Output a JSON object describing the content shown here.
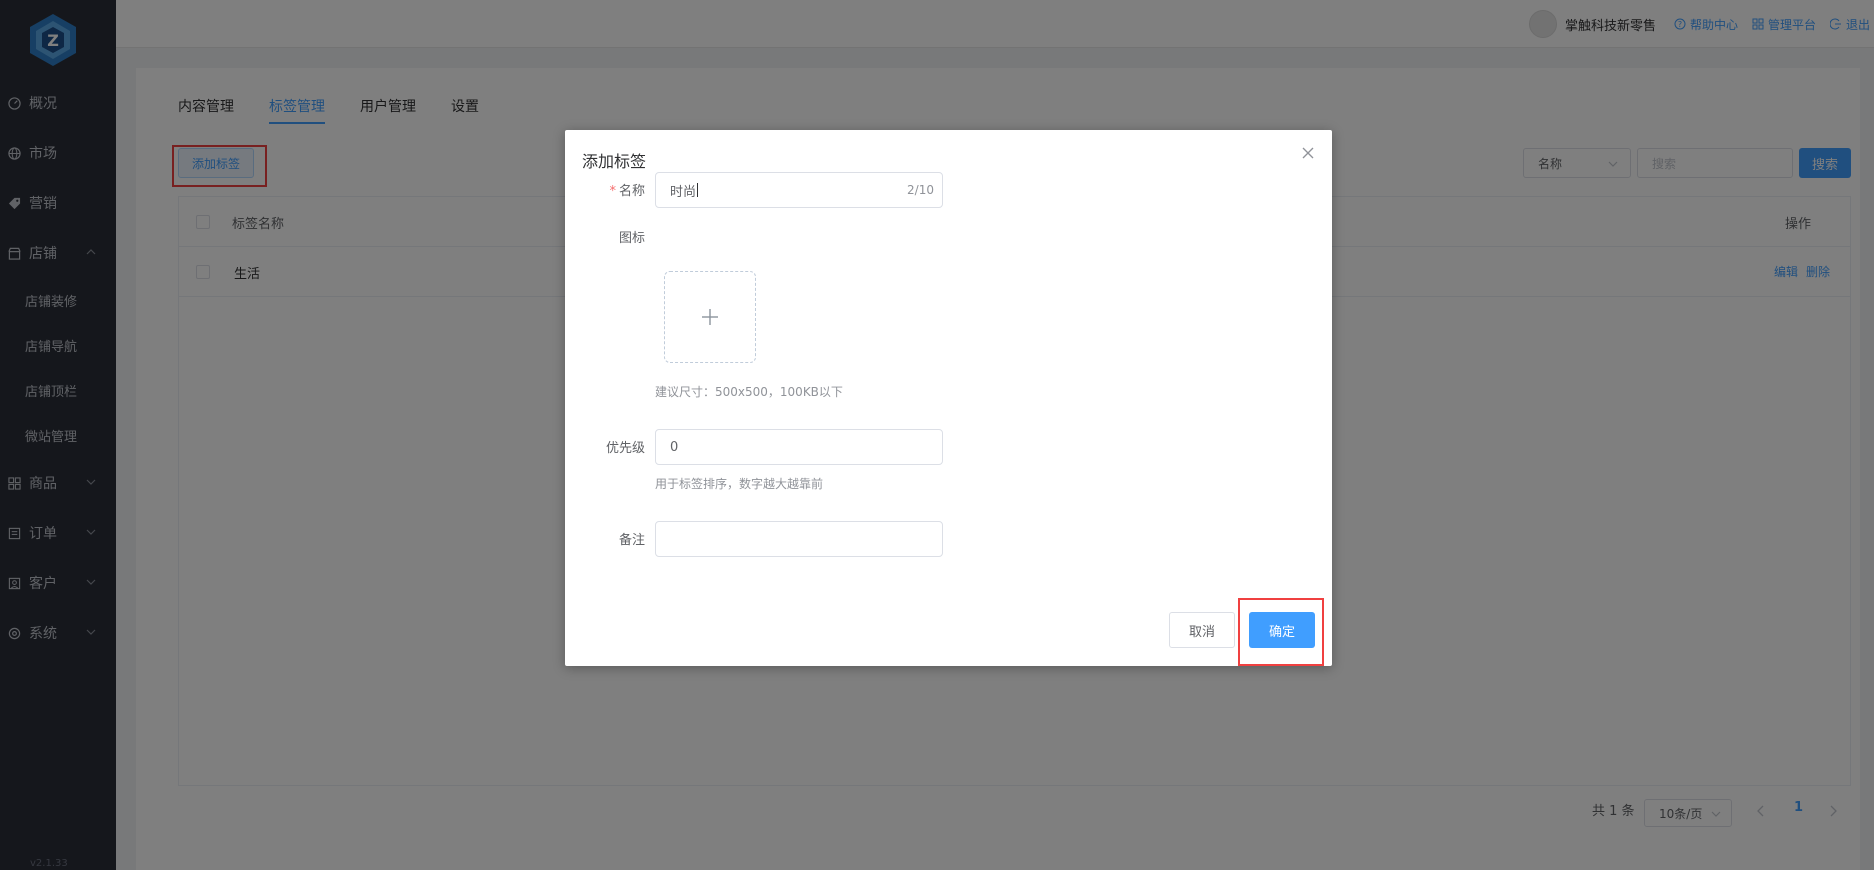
{
  "sidebar": {
    "items": [
      {
        "label": "概况",
        "icon": "gauge-icon"
      },
      {
        "label": "市场",
        "icon": "globe-icon"
      },
      {
        "label": "营销",
        "icon": "tag-icon"
      },
      {
        "label": "店铺",
        "icon": "store-icon",
        "expanded": true
      },
      {
        "label": "商品",
        "icon": "grid-icon"
      },
      {
        "label": "订单",
        "icon": "list-icon"
      },
      {
        "label": "客户",
        "icon": "user-card-icon"
      },
      {
        "label": "系统",
        "icon": "gear-icon"
      }
    ],
    "sub_items": [
      "店铺装修",
      "店铺导航",
      "店铺顶栏",
      "微站管理"
    ],
    "version": "v2.1.33"
  },
  "topbar": {
    "shop_name": "掌触科技新零售",
    "help": "帮助中心",
    "admin": "管理平台",
    "logout": "退出"
  },
  "tabs": [
    "内容管理",
    "标签管理",
    "用户管理",
    "设置"
  ],
  "active_tab": "标签管理",
  "toolbar": {
    "add_label": "添加标签",
    "filter_value": "名称",
    "search_placeholder": "搜索",
    "search_button": "搜索"
  },
  "table": {
    "columns": [
      "标签名称",
      "操作"
    ],
    "rows": [
      {
        "name": "生活",
        "edit": "编辑",
        "delete": "删除"
      }
    ]
  },
  "pagination": {
    "total": "共 1 条",
    "page_size": "10条/页",
    "current_page": "1"
  },
  "dialog": {
    "title": "添加标签",
    "name_label": "名称",
    "name_value": "时尚",
    "name_counter": "2/10",
    "icon_label": "图标",
    "icon_hint": "建议尺寸：500x500，100KB以下",
    "priority_label": "优先级",
    "priority_value": "0",
    "priority_hint": "用于标签排序，数字越大越靠前",
    "note_label": "备注",
    "note_value": "",
    "cancel": "取消",
    "confirm": "确定"
  },
  "colors": {
    "primary": "#409eff",
    "sidebar_bg": "#2b2f38",
    "highlight": "#f04040"
  }
}
